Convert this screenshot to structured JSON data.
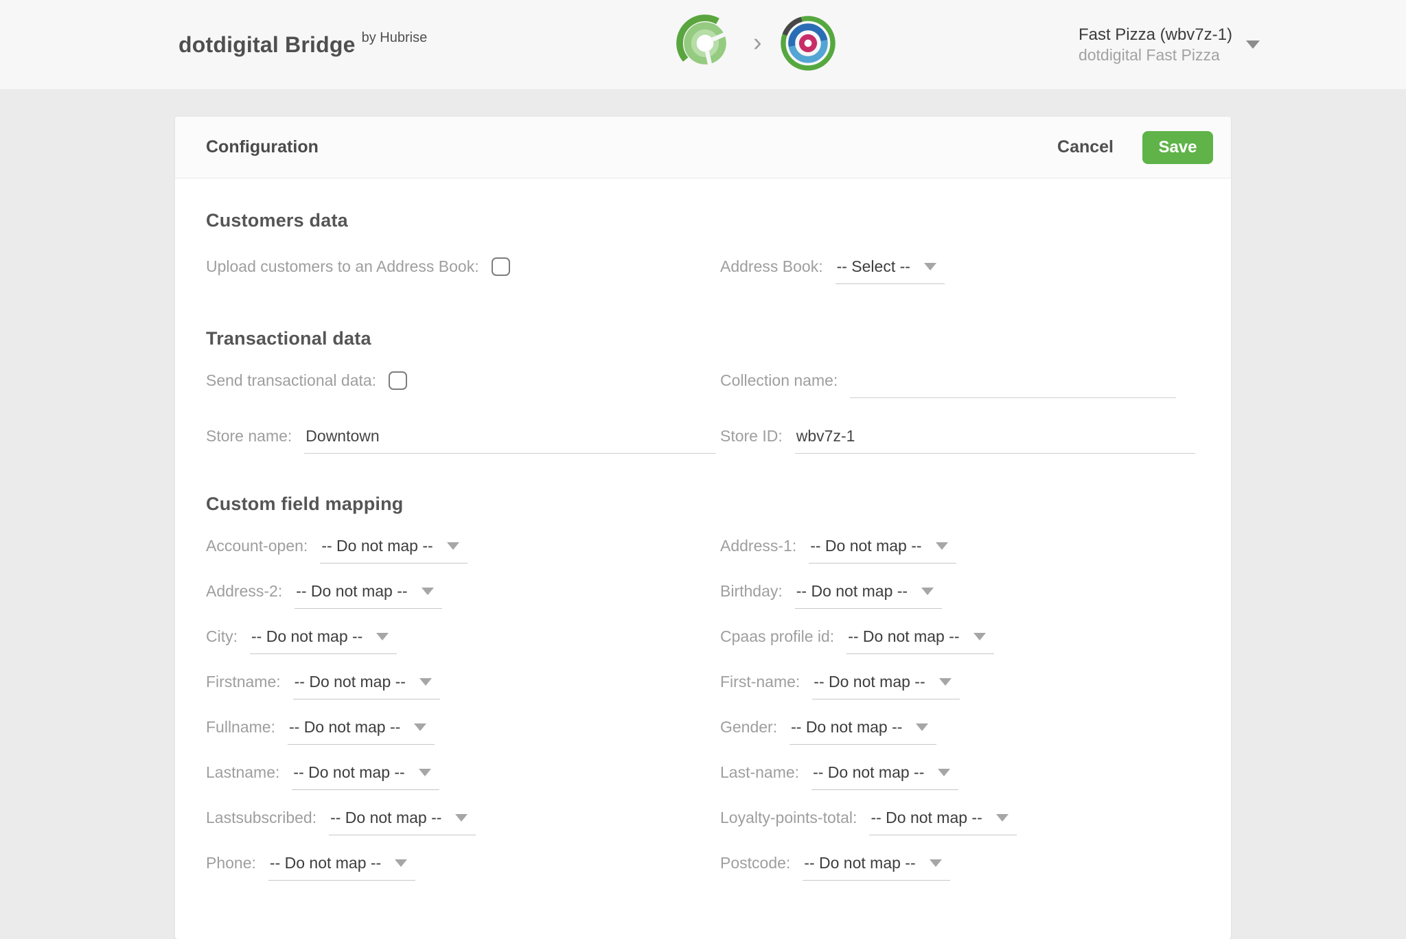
{
  "header": {
    "app_title": "dotdigital Bridge",
    "app_subtitle": "by Hubrise",
    "connector_chevron": "›",
    "account": {
      "name": "Fast Pizza (wbv7z-1)",
      "subname": "dotdigital Fast Pizza"
    }
  },
  "toolbar": {
    "title": "Configuration",
    "cancel_label": "Cancel",
    "save_label": "Save"
  },
  "sections": {
    "customers": {
      "title": "Customers data",
      "upload_label": "Upload customers to an Address Book:",
      "upload_checked": false,
      "address_book_label": "Address Book:",
      "address_book_value": "-- Select --"
    },
    "transactional": {
      "title": "Transactional data",
      "send_label": "Send transactional data:",
      "send_checked": false,
      "collection_label": "Collection name:",
      "collection_value": "",
      "store_name_label": "Store name:",
      "store_name_value": "Downtown",
      "store_id_label": "Store ID:",
      "store_id_value": "wbv7z-1"
    },
    "mapping": {
      "title": "Custom field mapping",
      "default_value": "-- Do not map --",
      "left_labels": [
        "Account-open:",
        "Address-2:",
        "City:",
        "Firstname:",
        "Fullname:",
        "Lastname:",
        "Lastsubscribed:",
        "Phone:"
      ],
      "right_labels": [
        "Address-1:",
        "Birthday:",
        "Cpaas profile id:",
        "First-name:",
        "Gender:",
        "Last-name:",
        "Loyalty-points-total:",
        "Postcode:"
      ]
    }
  },
  "icons": {
    "hubrise_logo": "hubrise-logo",
    "dotdigital_logo": "dotdigital-logo",
    "connector_chevron": "chevron-right",
    "dropdown_caret": "chevron-down"
  },
  "colors": {
    "save_button_green": "#5fb349",
    "header_bg": "#f7f7f7",
    "page_bg": "#ebebeb",
    "card_bg": "#ffffff",
    "heading_text": "#555555",
    "label_text": "#9e9e9e",
    "value_text": "#3d3d3d",
    "hubrise_green_dark": "#5aa53e",
    "hubrise_green_mid": "#94cb80",
    "hubrise_green_light": "#b7dda8",
    "dotdigital_green": "#55a83e",
    "dotdigital_blue_dark": "#2a6db4",
    "dotdigital_blue_light": "#54a4d4",
    "dotdigital_magenta": "#c72d67"
  }
}
